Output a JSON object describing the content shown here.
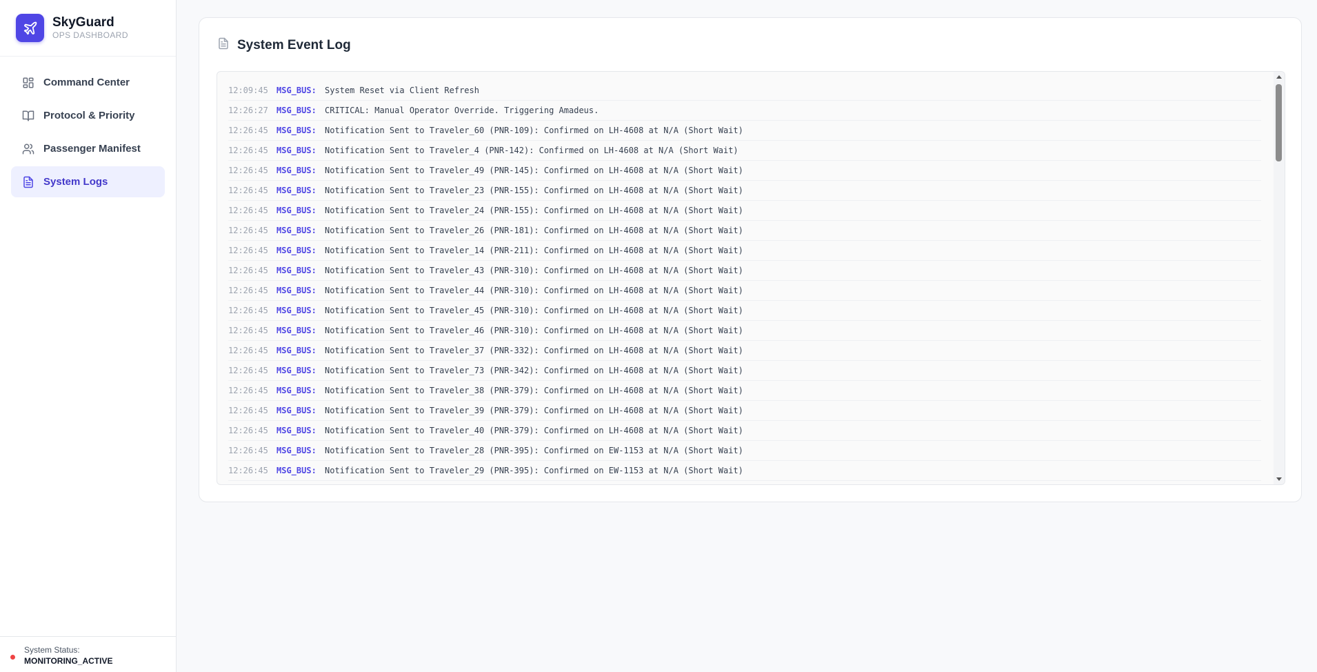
{
  "brand": {
    "name": "SkyGuard",
    "subtitle": "OPS DASHBOARD"
  },
  "nav": [
    {
      "label": "Command Center",
      "icon": "grid-icon",
      "active": false
    },
    {
      "label": "Protocol & Priority",
      "icon": "book-icon",
      "active": false
    },
    {
      "label": "Passenger Manifest",
      "icon": "users-icon",
      "active": false
    },
    {
      "label": "System Logs",
      "icon": "document-icon",
      "active": true
    }
  ],
  "status": {
    "label": "System Status:",
    "value": "MONITORING_ACTIVE",
    "color": "#ef4444"
  },
  "log": {
    "title": "System Event Log",
    "entries": [
      {
        "time": "12:09:45",
        "source": "MSG_BUS:",
        "message": "System Reset via Client Refresh"
      },
      {
        "time": "12:26:27",
        "source": "MSG_BUS:",
        "message": "CRITICAL: Manual Operator Override. Triggering Amadeus."
      },
      {
        "time": "12:26:45",
        "source": "MSG_BUS:",
        "message": "Notification Sent to Traveler_60 (PNR-109): Confirmed on LH-4608 at N/A (Short Wait)"
      },
      {
        "time": "12:26:45",
        "source": "MSG_BUS:",
        "message": "Notification Sent to Traveler_4 (PNR-142): Confirmed on LH-4608 at N/A (Short Wait)"
      },
      {
        "time": "12:26:45",
        "source": "MSG_BUS:",
        "message": "Notification Sent to Traveler_49 (PNR-145): Confirmed on LH-4608 at N/A (Short Wait)"
      },
      {
        "time": "12:26:45",
        "source": "MSG_BUS:",
        "message": "Notification Sent to Traveler_23 (PNR-155): Confirmed on LH-4608 at N/A (Short Wait)"
      },
      {
        "time": "12:26:45",
        "source": "MSG_BUS:",
        "message": "Notification Sent to Traveler_24 (PNR-155): Confirmed on LH-4608 at N/A (Short Wait)"
      },
      {
        "time": "12:26:45",
        "source": "MSG_BUS:",
        "message": "Notification Sent to Traveler_26 (PNR-181): Confirmed on LH-4608 at N/A (Short Wait)"
      },
      {
        "time": "12:26:45",
        "source": "MSG_BUS:",
        "message": "Notification Sent to Traveler_14 (PNR-211): Confirmed on LH-4608 at N/A (Short Wait)"
      },
      {
        "time": "12:26:45",
        "source": "MSG_BUS:",
        "message": "Notification Sent to Traveler_43 (PNR-310): Confirmed on LH-4608 at N/A (Short Wait)"
      },
      {
        "time": "12:26:45",
        "source": "MSG_BUS:",
        "message": "Notification Sent to Traveler_44 (PNR-310): Confirmed on LH-4608 at N/A (Short Wait)"
      },
      {
        "time": "12:26:45",
        "source": "MSG_BUS:",
        "message": "Notification Sent to Traveler_45 (PNR-310): Confirmed on LH-4608 at N/A (Short Wait)"
      },
      {
        "time": "12:26:45",
        "source": "MSG_BUS:",
        "message": "Notification Sent to Traveler_46 (PNR-310): Confirmed on LH-4608 at N/A (Short Wait)"
      },
      {
        "time": "12:26:45",
        "source": "MSG_BUS:",
        "message": "Notification Sent to Traveler_37 (PNR-332): Confirmed on LH-4608 at N/A (Short Wait)"
      },
      {
        "time": "12:26:45",
        "source": "MSG_BUS:",
        "message": "Notification Sent to Traveler_73 (PNR-342): Confirmed on LH-4608 at N/A (Short Wait)"
      },
      {
        "time": "12:26:45",
        "source": "MSG_BUS:",
        "message": "Notification Sent to Traveler_38 (PNR-379): Confirmed on LH-4608 at N/A (Short Wait)"
      },
      {
        "time": "12:26:45",
        "source": "MSG_BUS:",
        "message": "Notification Sent to Traveler_39 (PNR-379): Confirmed on LH-4608 at N/A (Short Wait)"
      },
      {
        "time": "12:26:45",
        "source": "MSG_BUS:",
        "message": "Notification Sent to Traveler_40 (PNR-379): Confirmed on LH-4608 at N/A (Short Wait)"
      },
      {
        "time": "12:26:45",
        "source": "MSG_BUS:",
        "message": "Notification Sent to Traveler_28 (PNR-395): Confirmed on EW-1153 at N/A (Short Wait)"
      },
      {
        "time": "12:26:45",
        "source": "MSG_BUS:",
        "message": "Notification Sent to Traveler_29 (PNR-395): Confirmed on EW-1153 at N/A (Short Wait)"
      }
    ]
  }
}
